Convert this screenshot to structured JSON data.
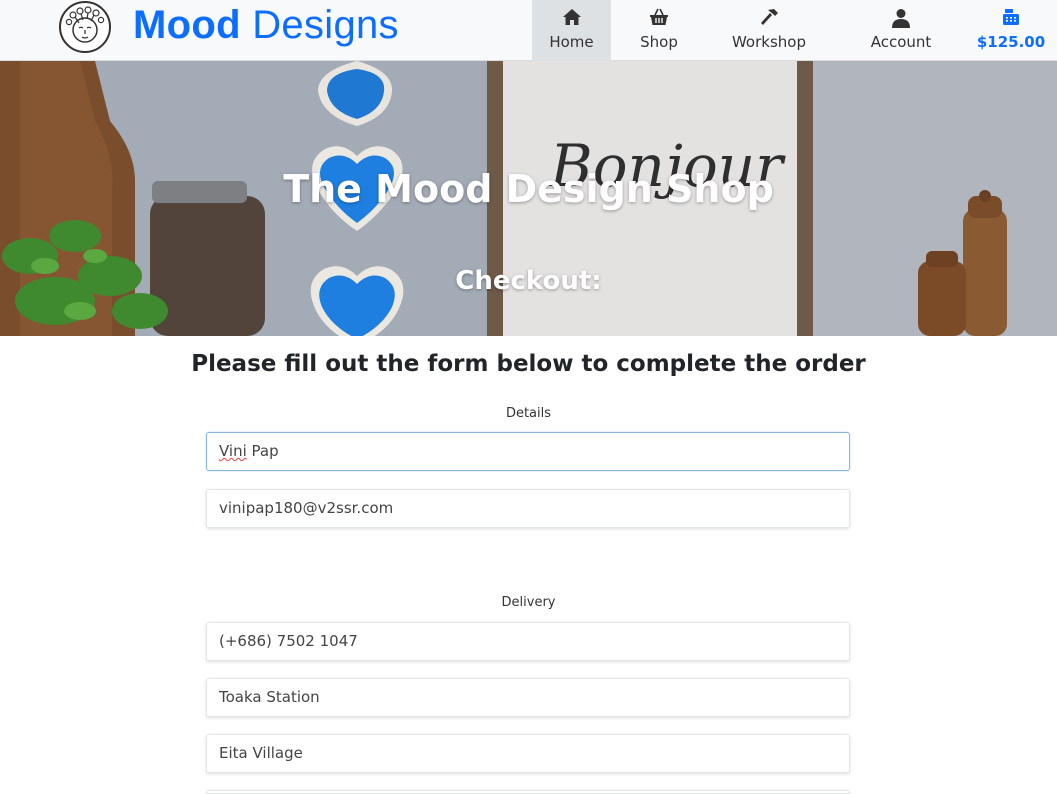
{
  "brand": {
    "name_part1": "Mood",
    "name_part2": " Designs",
    "color": "#0d6efd"
  },
  "nav": {
    "items": [
      {
        "label": "Home",
        "icon": "home-icon",
        "active": true
      },
      {
        "label": "Shop",
        "icon": "basket-icon",
        "active": false
      },
      {
        "label": "Workshop",
        "icon": "hammer-icon",
        "active": false
      },
      {
        "label": "Account",
        "icon": "user-icon",
        "active": false
      }
    ],
    "cart": {
      "label": "$125.00",
      "icon": "cash-register-icon"
    }
  },
  "hero": {
    "title": "The Mood Design Shop",
    "subtitle": "Checkout:",
    "sign_text": "Bonjour"
  },
  "form": {
    "heading": "Please fill out the form below to complete the order",
    "details_label": "Details",
    "name_value_first": "Vini",
    "name_value_rest": " Pap",
    "email_value": "vinipap180@v2ssr.com",
    "delivery_label": "Delivery",
    "phone_value": "(+686) 7502 1047",
    "address1_value": "Toaka Station",
    "address2_value": "Eita Village"
  }
}
